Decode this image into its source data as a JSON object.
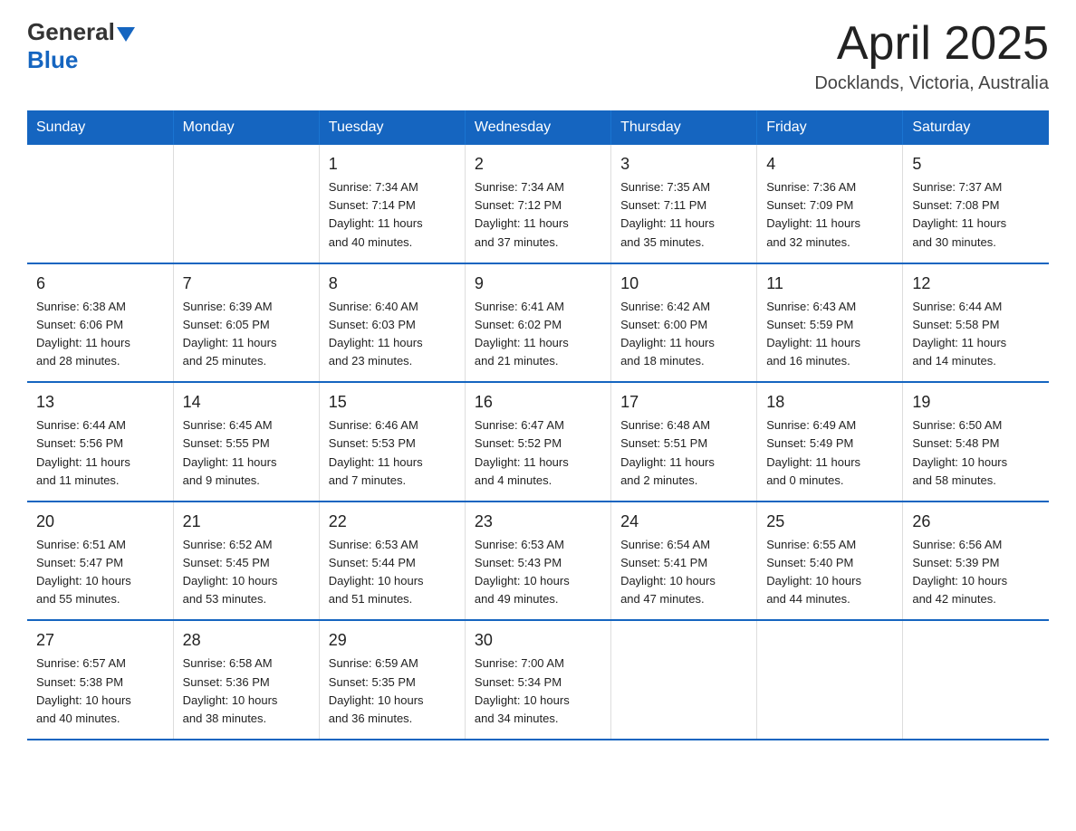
{
  "header": {
    "logo_general": "General",
    "logo_blue": "Blue",
    "month_title": "April 2025",
    "location": "Docklands, Victoria, Australia"
  },
  "days_of_week": [
    "Sunday",
    "Monday",
    "Tuesday",
    "Wednesday",
    "Thursday",
    "Friday",
    "Saturday"
  ],
  "weeks": [
    [
      {
        "day": "",
        "info": ""
      },
      {
        "day": "",
        "info": ""
      },
      {
        "day": "1",
        "info": "Sunrise: 7:34 AM\nSunset: 7:14 PM\nDaylight: 11 hours\nand 40 minutes."
      },
      {
        "day": "2",
        "info": "Sunrise: 7:34 AM\nSunset: 7:12 PM\nDaylight: 11 hours\nand 37 minutes."
      },
      {
        "day": "3",
        "info": "Sunrise: 7:35 AM\nSunset: 7:11 PM\nDaylight: 11 hours\nand 35 minutes."
      },
      {
        "day": "4",
        "info": "Sunrise: 7:36 AM\nSunset: 7:09 PM\nDaylight: 11 hours\nand 32 minutes."
      },
      {
        "day": "5",
        "info": "Sunrise: 7:37 AM\nSunset: 7:08 PM\nDaylight: 11 hours\nand 30 minutes."
      }
    ],
    [
      {
        "day": "6",
        "info": "Sunrise: 6:38 AM\nSunset: 6:06 PM\nDaylight: 11 hours\nand 28 minutes."
      },
      {
        "day": "7",
        "info": "Sunrise: 6:39 AM\nSunset: 6:05 PM\nDaylight: 11 hours\nand 25 minutes."
      },
      {
        "day": "8",
        "info": "Sunrise: 6:40 AM\nSunset: 6:03 PM\nDaylight: 11 hours\nand 23 minutes."
      },
      {
        "day": "9",
        "info": "Sunrise: 6:41 AM\nSunset: 6:02 PM\nDaylight: 11 hours\nand 21 minutes."
      },
      {
        "day": "10",
        "info": "Sunrise: 6:42 AM\nSunset: 6:00 PM\nDaylight: 11 hours\nand 18 minutes."
      },
      {
        "day": "11",
        "info": "Sunrise: 6:43 AM\nSunset: 5:59 PM\nDaylight: 11 hours\nand 16 minutes."
      },
      {
        "day": "12",
        "info": "Sunrise: 6:44 AM\nSunset: 5:58 PM\nDaylight: 11 hours\nand 14 minutes."
      }
    ],
    [
      {
        "day": "13",
        "info": "Sunrise: 6:44 AM\nSunset: 5:56 PM\nDaylight: 11 hours\nand 11 minutes."
      },
      {
        "day": "14",
        "info": "Sunrise: 6:45 AM\nSunset: 5:55 PM\nDaylight: 11 hours\nand 9 minutes."
      },
      {
        "day": "15",
        "info": "Sunrise: 6:46 AM\nSunset: 5:53 PM\nDaylight: 11 hours\nand 7 minutes."
      },
      {
        "day": "16",
        "info": "Sunrise: 6:47 AM\nSunset: 5:52 PM\nDaylight: 11 hours\nand 4 minutes."
      },
      {
        "day": "17",
        "info": "Sunrise: 6:48 AM\nSunset: 5:51 PM\nDaylight: 11 hours\nand 2 minutes."
      },
      {
        "day": "18",
        "info": "Sunrise: 6:49 AM\nSunset: 5:49 PM\nDaylight: 11 hours\nand 0 minutes."
      },
      {
        "day": "19",
        "info": "Sunrise: 6:50 AM\nSunset: 5:48 PM\nDaylight: 10 hours\nand 58 minutes."
      }
    ],
    [
      {
        "day": "20",
        "info": "Sunrise: 6:51 AM\nSunset: 5:47 PM\nDaylight: 10 hours\nand 55 minutes."
      },
      {
        "day": "21",
        "info": "Sunrise: 6:52 AM\nSunset: 5:45 PM\nDaylight: 10 hours\nand 53 minutes."
      },
      {
        "day": "22",
        "info": "Sunrise: 6:53 AM\nSunset: 5:44 PM\nDaylight: 10 hours\nand 51 minutes."
      },
      {
        "day": "23",
        "info": "Sunrise: 6:53 AM\nSunset: 5:43 PM\nDaylight: 10 hours\nand 49 minutes."
      },
      {
        "day": "24",
        "info": "Sunrise: 6:54 AM\nSunset: 5:41 PM\nDaylight: 10 hours\nand 47 minutes."
      },
      {
        "day": "25",
        "info": "Sunrise: 6:55 AM\nSunset: 5:40 PM\nDaylight: 10 hours\nand 44 minutes."
      },
      {
        "day": "26",
        "info": "Sunrise: 6:56 AM\nSunset: 5:39 PM\nDaylight: 10 hours\nand 42 minutes."
      }
    ],
    [
      {
        "day": "27",
        "info": "Sunrise: 6:57 AM\nSunset: 5:38 PM\nDaylight: 10 hours\nand 40 minutes."
      },
      {
        "day": "28",
        "info": "Sunrise: 6:58 AM\nSunset: 5:36 PM\nDaylight: 10 hours\nand 38 minutes."
      },
      {
        "day": "29",
        "info": "Sunrise: 6:59 AM\nSunset: 5:35 PM\nDaylight: 10 hours\nand 36 minutes."
      },
      {
        "day": "30",
        "info": "Sunrise: 7:00 AM\nSunset: 5:34 PM\nDaylight: 10 hours\nand 34 minutes."
      },
      {
        "day": "",
        "info": ""
      },
      {
        "day": "",
        "info": ""
      },
      {
        "day": "",
        "info": ""
      }
    ]
  ]
}
